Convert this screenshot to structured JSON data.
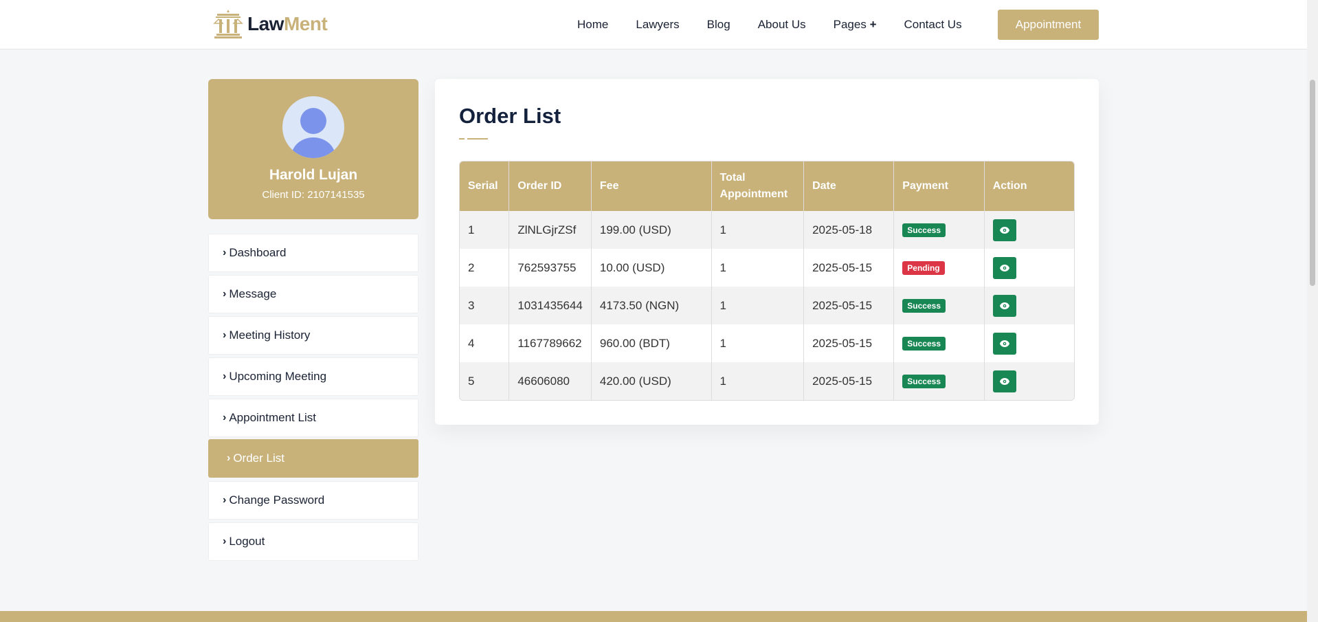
{
  "brand": {
    "name_part1": "Law",
    "name_part2": "Ment",
    "accent_color": "#c8b27a"
  },
  "nav": {
    "items": [
      {
        "label": "Home"
      },
      {
        "label": "Lawyers"
      },
      {
        "label": "Blog"
      },
      {
        "label": "About Us"
      },
      {
        "label": "Pages"
      },
      {
        "label": "Contact Us"
      }
    ],
    "appointment_label": "Appointment"
  },
  "profile": {
    "name": "Harold Lujan",
    "client_id": "Client ID: 2107141535"
  },
  "sidebar": {
    "items": [
      {
        "label": "Dashboard"
      },
      {
        "label": "Message"
      },
      {
        "label": "Meeting History"
      },
      {
        "label": "Upcoming Meeting"
      },
      {
        "label": "Appointment List"
      },
      {
        "label": "Order List"
      },
      {
        "label": "Change Password"
      },
      {
        "label": "Logout"
      }
    ],
    "active_index": 5
  },
  "main": {
    "title": "Order List",
    "columns": [
      "Serial",
      "Order ID",
      "Fee",
      "Total Appointment",
      "Date",
      "Payment",
      "Action"
    ],
    "rows": [
      {
        "serial": "1",
        "order_id": "ZlNLGjrZSf",
        "fee": "199.00 (USD)",
        "total": "1",
        "date": "2025-05-18",
        "payment": "Success",
        "status": "success"
      },
      {
        "serial": "2",
        "order_id": "762593755",
        "fee": "10.00 (USD)",
        "total": "1",
        "date": "2025-05-15",
        "payment": "Pending",
        "status": "pending"
      },
      {
        "serial": "3",
        "order_id": "1031435644",
        "fee": "4173.50 (NGN)",
        "total": "1",
        "date": "2025-05-15",
        "payment": "Success",
        "status": "success"
      },
      {
        "serial": "4",
        "order_id": "1167789662",
        "fee": "960.00 (BDT)",
        "total": "1",
        "date": "2025-05-15",
        "payment": "Success",
        "status": "success"
      },
      {
        "serial": "5",
        "order_id": "46606080",
        "fee": "420.00 (USD)",
        "total": "1",
        "date": "2025-05-15",
        "payment": "Success",
        "status": "success"
      }
    ],
    "action_icon": "eye-icon"
  }
}
